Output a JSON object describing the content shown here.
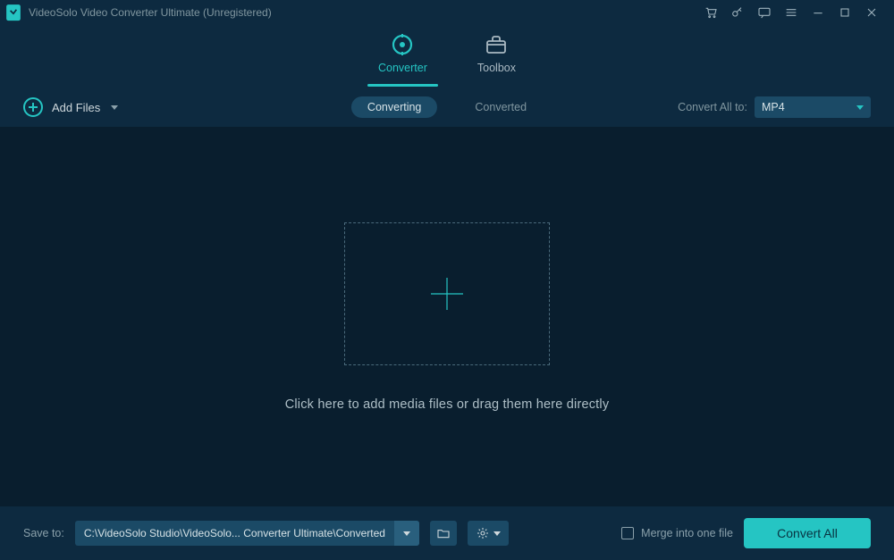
{
  "titlebar": {
    "app_title": "VideoSolo Video Converter Ultimate (Unregistered)"
  },
  "header": {
    "tab_converter": "Converter",
    "tab_toolbox": "Toolbox"
  },
  "toolbar": {
    "add_files_label": "Add Files",
    "pill_converting": "Converting",
    "pill_converted": "Converted",
    "convert_all_to_label": "Convert All to:",
    "selected_format": "MP4"
  },
  "main": {
    "drop_text": "Click here to add media files or drag them here directly"
  },
  "bottombar": {
    "save_to_label": "Save to:",
    "save_path": "C:\\VideoSolo Studio\\VideoSolo... Converter Ultimate\\Converted",
    "merge_label": "Merge into one file",
    "convert_all_button": "Convert All"
  },
  "colors": {
    "accent": "#25c5c3",
    "bg_dark": "#091e2e",
    "bg_panel": "#0d2a40",
    "bg_control": "#1b4a66"
  }
}
